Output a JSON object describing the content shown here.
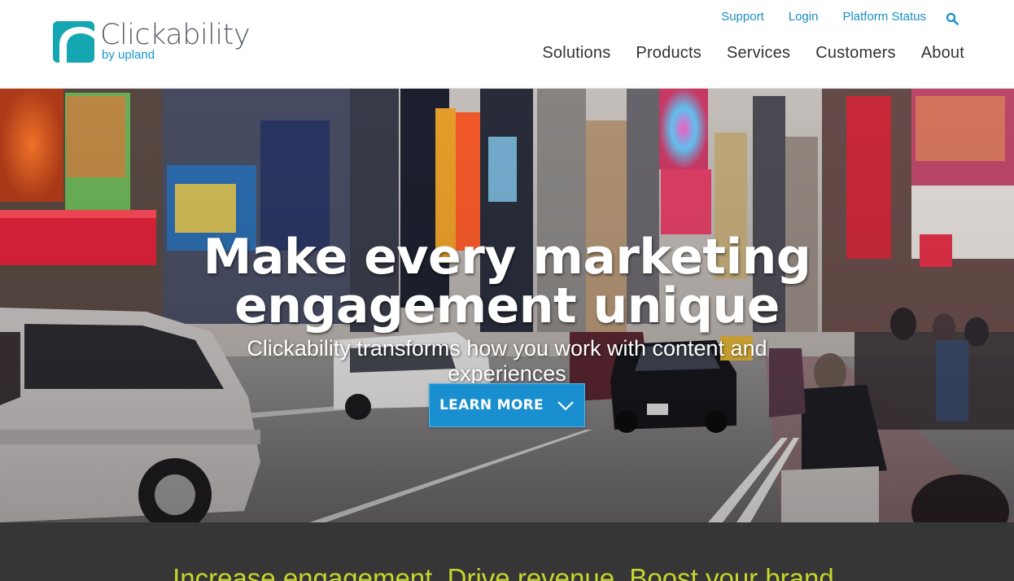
{
  "brand": {
    "name": "Clickability",
    "sub": "by upland",
    "colors": {
      "teal": "#14a7b1",
      "blue": "#1a8ec4",
      "lime": "#c7d62c"
    }
  },
  "utility_nav": {
    "items": [
      {
        "label": "Support"
      },
      {
        "label": "Login"
      },
      {
        "label": "Platform Status"
      }
    ],
    "search_icon": "search-icon"
  },
  "main_nav": {
    "items": [
      {
        "label": "Solutions"
      },
      {
        "label": "Products"
      },
      {
        "label": "Services"
      },
      {
        "label": "Customers"
      },
      {
        "label": "About"
      }
    ]
  },
  "hero": {
    "title_line1": "Make every marketing",
    "title_line2": "engagement unique",
    "subtitle": "Clickability transforms how you work with content and experiences",
    "cta_label": "LEARN MORE",
    "cta_icon": "chevron-down-icon"
  },
  "tagline": {
    "text": "Increase engagement. Drive revenue. Boost your brand."
  }
}
